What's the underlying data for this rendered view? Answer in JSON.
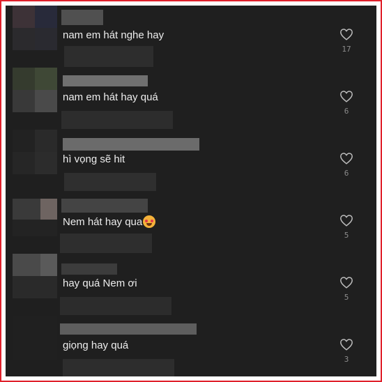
{
  "colors": {
    "frame_border": "#e0212b",
    "background": "#1f1f1f",
    "comment_text": "#ededed",
    "count_text": "#8c8c8c",
    "heart_stroke": "#bdbdbd"
  },
  "comments": [
    {
      "text": "nam em hát nghe hay",
      "likes": "17"
    },
    {
      "text": "nam em hát hay quá",
      "likes": "6"
    },
    {
      "text": "hì vọng sẽ hit",
      "likes": "6"
    },
    {
      "text": "Nem hát hay qua",
      "emoji": "smiling-face-with-hearts",
      "likes": "5"
    },
    {
      "text": "hay quá Nem ơi",
      "likes": "5"
    },
    {
      "text": "giọng hay quá",
      "likes": "3"
    }
  ]
}
